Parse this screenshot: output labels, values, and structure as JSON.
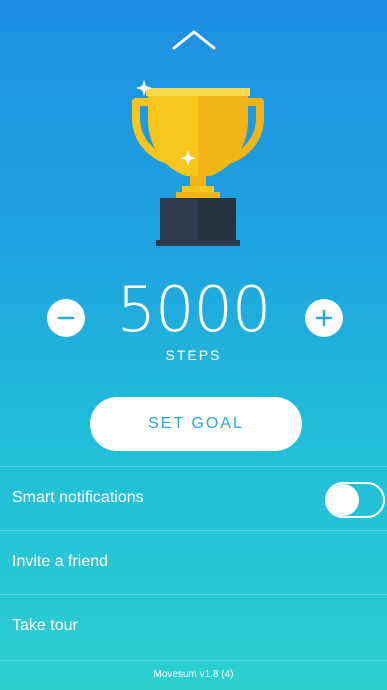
{
  "header": {
    "collapse_icon": "chevron-up-icon"
  },
  "goal": {
    "icon": "trophy-icon",
    "value": "5000",
    "unit": "STEPS",
    "decrease_icon": "minus-icon",
    "increase_icon": "plus-icon",
    "set_goal_label": "SET GOAL"
  },
  "settings": {
    "smart_notifications": {
      "label": "Smart notifications",
      "enabled": false
    },
    "invite_friend_label": "Invite a friend",
    "take_tour_label": "Take tour"
  },
  "footer": {
    "version": "Movesum v1.8 (4)"
  },
  "colors": {
    "gradient_top": "#1f8fe3",
    "gradient_bottom": "#2ccfd0",
    "accent": "#2aa6dc",
    "trophy_gold": "#f8c51c",
    "trophy_base": "#2f3b4d"
  }
}
